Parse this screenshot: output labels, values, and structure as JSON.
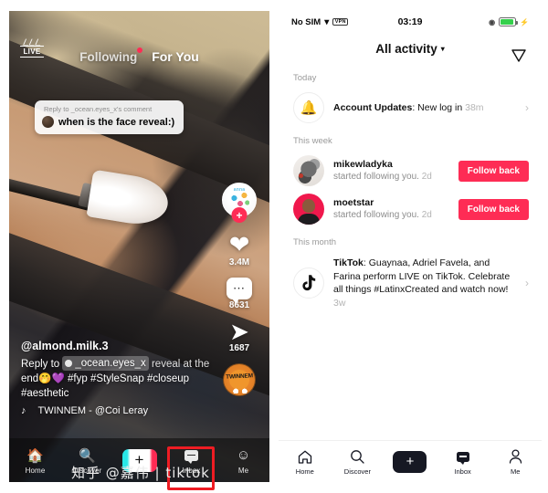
{
  "left_panel": {
    "live_badge": "LIVE",
    "tabs": {
      "following": "Following",
      "for_you": "For You"
    },
    "reply_card": {
      "header": "Reply to _ocean.eyes_x's comment",
      "text": "when is the face reveal:)"
    },
    "rail": {
      "avatar_label": "anna",
      "plus": "+",
      "like_count": "3.4M",
      "comment_count": "8631",
      "share_count": "1687",
      "disc_label": "TWINNEM"
    },
    "caption": {
      "username": "@almond.milk.3",
      "reply_prefix": "Reply to",
      "reply_mention": "_ocean.eyes_x",
      "line1_rest": "reveal at the",
      "line2": "end🤭💜  #fyp #StyleSnap #closeup",
      "line3": "#aesthetic",
      "music_note": "♪",
      "music": "TWINNEM - @Coi Leray"
    },
    "nav": [
      {
        "label": "Home",
        "icon": "home-icon"
      },
      {
        "label": "Discover",
        "icon": "search-icon"
      },
      {
        "label": "",
        "icon": "plus-icon"
      },
      {
        "label": "Inbox",
        "icon": "inbox-icon"
      },
      {
        "label": "Me",
        "icon": "profile-icon"
      }
    ]
  },
  "right_panel": {
    "statusbar": {
      "carrier": "No SIM",
      "wifi": "▾",
      "vpn": "VPN",
      "time": "03:19",
      "lock": "◉",
      "bolt": "⚡"
    },
    "header": {
      "title": "All activity",
      "caret": "▾",
      "filter_icon": "funnel-icon"
    },
    "sections": [
      {
        "label": "Today",
        "items": [
          {
            "type": "account-update",
            "icon": "bell-icon",
            "title": "Account Updates",
            "body": ": New log in",
            "time": "38m",
            "chevron": "›"
          }
        ]
      },
      {
        "label": "This week",
        "items": [
          {
            "type": "follow",
            "avatar": "sketch-avatar",
            "username": "mikewladyka",
            "subtitle": "started following you.",
            "time": "2d",
            "button": "Follow back"
          },
          {
            "type": "follow",
            "avatar": "person-avatar",
            "username": "moetstar",
            "subtitle": "started following you.",
            "time": "2d",
            "button": "Follow back"
          }
        ]
      },
      {
        "label": "This month",
        "items": [
          {
            "type": "announcement",
            "icon": "tiktok-note-icon",
            "title": "TikTok",
            "body": ": Guaynaa, Adriel Favela, and Farina perform LIVE on TikTok. Celebrate all things #LatinxCreated and watch now!",
            "time": "3w",
            "chevron": "›"
          }
        ]
      }
    ],
    "nav": [
      {
        "label": "Home",
        "icon": "home-icon"
      },
      {
        "label": "Discover",
        "icon": "search-icon"
      },
      {
        "label": "",
        "icon": "plus-icon"
      },
      {
        "label": "Inbox",
        "icon": "inbox-icon"
      },
      {
        "label": "Me",
        "icon": "profile-icon"
      }
    ]
  },
  "watermark": "知乎 @嘉伟 | tiktok",
  "colors": {
    "accent_red": "#fe2c55",
    "accent_cyan": "#25f4ee",
    "highlight_box": "#ee1c23"
  }
}
